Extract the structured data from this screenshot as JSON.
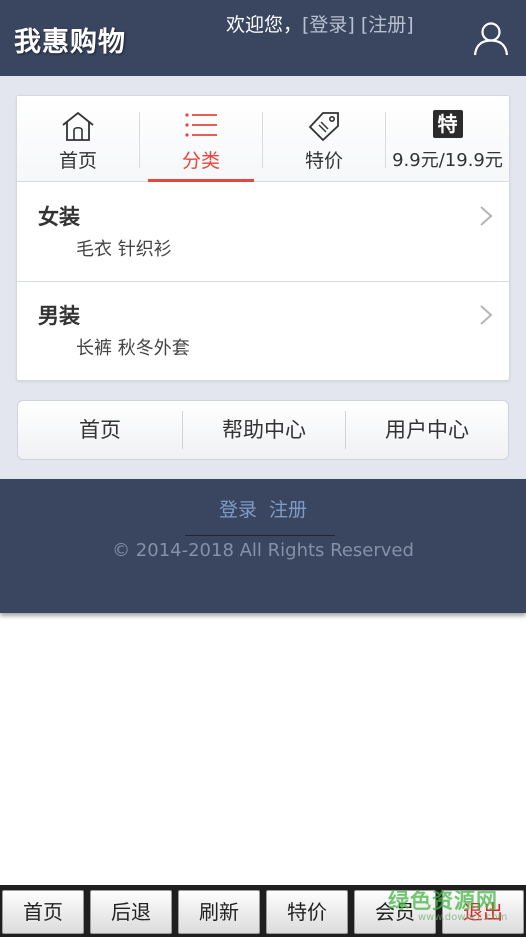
{
  "header": {
    "brand": "我惠购物",
    "welcome": "欢迎您，",
    "login_link": "[登录]",
    "register_link": "[注册]"
  },
  "nav": {
    "items": [
      {
        "label": "首页",
        "icon": "home-icon"
      },
      {
        "label": "分类",
        "icon": "list-icon",
        "active": true
      },
      {
        "label": "特价",
        "icon": "price-tag-icon"
      },
      {
        "label": "9.9元/19.9元",
        "badge": "特"
      }
    ]
  },
  "categories": [
    {
      "title": "女装",
      "sub": "毛衣  针织衫"
    },
    {
      "title": "男装",
      "sub": "长裤  秋冬外套"
    }
  ],
  "linkbar": [
    "首页",
    "帮助中心",
    "用户中心"
  ],
  "footer": {
    "login": "登录",
    "register": "注册",
    "copyright": "© 2014-2018 All Rights Reserved"
  },
  "toolbar": [
    "首页",
    "后退",
    "刷新",
    "特价",
    "会员",
    "退出"
  ],
  "watermark": {
    "text": "绿色资源网",
    "url": "www.downcc.com"
  },
  "colors": {
    "header_bg": "#3a4560",
    "accent": "#e4473b",
    "band_bg": "#e3e6ee"
  }
}
